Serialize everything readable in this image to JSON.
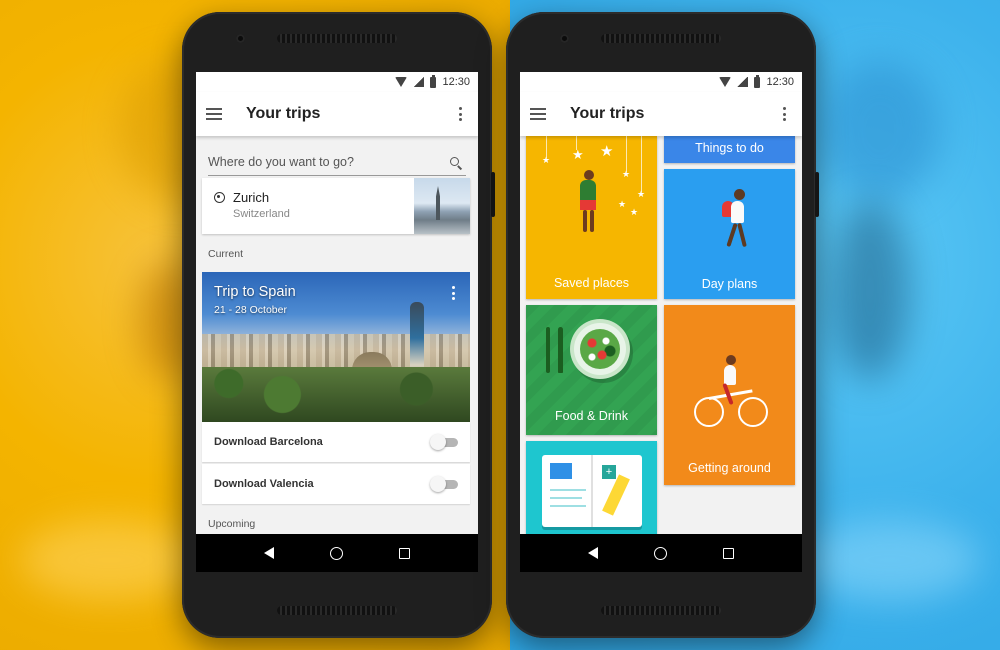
{
  "status": {
    "time": "12:30"
  },
  "left_screen": {
    "appbar": {
      "title": "Your trips"
    },
    "search": {
      "placeholder": "Where do you want to go?"
    },
    "destination": {
      "city": "Zurich",
      "country": "Switzerland"
    },
    "sections": {
      "current": "Current",
      "upcoming": "Upcoming"
    },
    "trip": {
      "title": "Trip to Spain",
      "dates": "21 - 28 October"
    },
    "downloads": [
      {
        "label": "Download Barcelona",
        "enabled": false
      },
      {
        "label": "Download Valencia",
        "enabled": false
      }
    ]
  },
  "right_screen": {
    "appbar": {
      "title": "Your trips"
    },
    "tiles": {
      "things_to_do": "Things to do",
      "saved_places": "Saved places",
      "day_plans": "Day plans",
      "food_drink": "Food & Drink",
      "getting_around": "Getting around"
    }
  },
  "colors": {
    "left_background": "#f4b400",
    "right_background": "#3db2ec",
    "saved_tile": "#f6b600",
    "things_tile": "#3a86e8",
    "day_tile": "#2a9ef0",
    "food_tile": "#33a352",
    "around_tile": "#f28a1a",
    "guide_tile": "#1ec6cf"
  },
  "icons": [
    "menu-icon",
    "more-vert-icon",
    "search-icon",
    "location-pin-icon",
    "back-icon",
    "home-icon",
    "recents-icon",
    "wifi-icon",
    "signal-icon",
    "battery-icon"
  ]
}
